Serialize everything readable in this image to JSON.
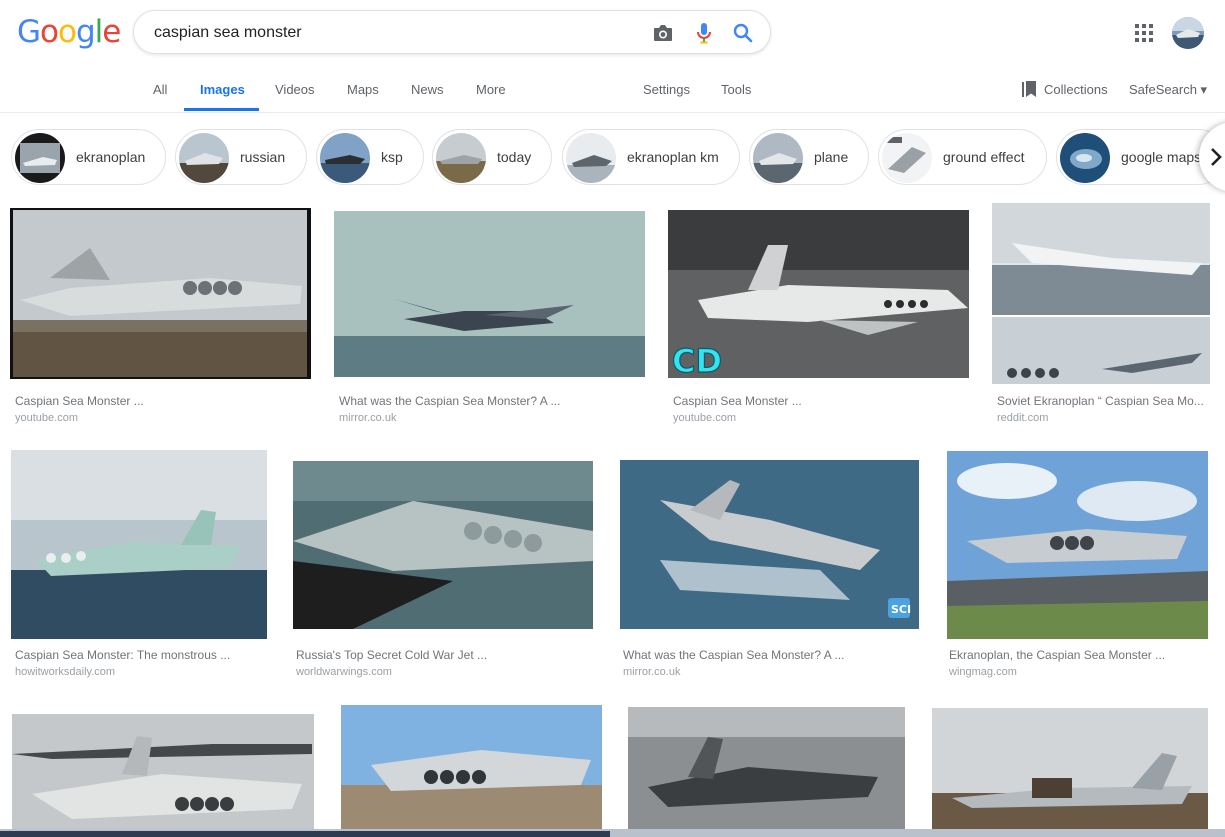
{
  "search": {
    "query": "caspian sea monster"
  },
  "icons": {
    "camera": "camera-icon",
    "mic": "microphone-icon",
    "search": "search-icon",
    "apps": "apps-grid-icon",
    "collections": "bookmark-icon",
    "next": "chevron-right-icon"
  },
  "colors": {
    "accent": "#1a73e8",
    "blue": "#4285f4",
    "red": "#ea4335",
    "yellow": "#fbbc05",
    "green": "#34a853"
  },
  "tabs": [
    {
      "label": "All"
    },
    {
      "label": "Images",
      "active": true
    },
    {
      "label": "Videos"
    },
    {
      "label": "Maps"
    },
    {
      "label": "News"
    },
    {
      "label": "More"
    }
  ],
  "tools": {
    "settings": "Settings",
    "tools": "Tools",
    "collections": "Collections",
    "safesearch": "SafeSearch"
  },
  "chips": [
    {
      "label": "ekranoplan"
    },
    {
      "label": "russian"
    },
    {
      "label": "ksp"
    },
    {
      "label": "today"
    },
    {
      "label": "ekranoplan km"
    },
    {
      "label": "plane"
    },
    {
      "label": "ground effect"
    },
    {
      "label": "google maps"
    }
  ],
  "results": [
    {
      "title": "Caspian Sea Monster ...",
      "source": "youtube.com"
    },
    {
      "title": "What was the Caspian Sea Monster? A ...",
      "source": "mirror.co.uk"
    },
    {
      "title": "Caspian Sea Monster ...",
      "source": "youtube.com",
      "overlay": "CD"
    },
    {
      "title": "Soviet Ekranoplan “ Caspian Sea Mo...",
      "source": "reddit.com"
    },
    {
      "title": "Caspian Sea Monster: The monstrous ...",
      "source": "howitworksdaily.com"
    },
    {
      "title": "Russia's Top Secret Cold War Jet ...",
      "source": "worldwarwings.com"
    },
    {
      "title": "What was the Caspian Sea Monster? A ...",
      "source": "mirror.co.uk",
      "overlay": "SCI"
    },
    {
      "title": "Ekranoplan, the Caspian Sea Monster ...",
      "source": "wingmag.com"
    },
    {
      "title": "",
      "source": ""
    },
    {
      "title": "",
      "source": ""
    },
    {
      "title": "",
      "source": ""
    },
    {
      "title": "",
      "source": ""
    }
  ]
}
